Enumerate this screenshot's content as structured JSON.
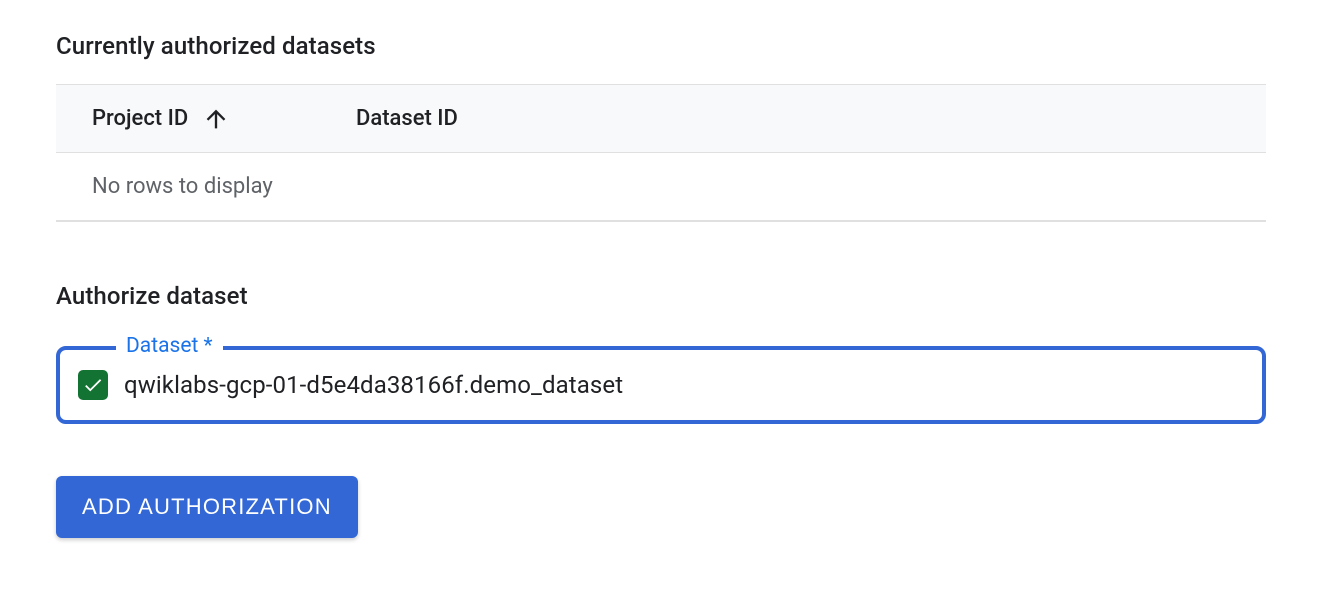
{
  "current_section": {
    "title": "Currently authorized datasets",
    "columns": {
      "project_id": "Project ID",
      "dataset_id": "Dataset ID"
    },
    "empty_message": "No rows to display"
  },
  "authorize_section": {
    "title": "Authorize dataset",
    "field_label": "Dataset *",
    "selected_value": "qwiklabs-gcp-01-d5e4da38166f.demo_dataset",
    "button_label": "ADD AUTHORIZATION"
  }
}
